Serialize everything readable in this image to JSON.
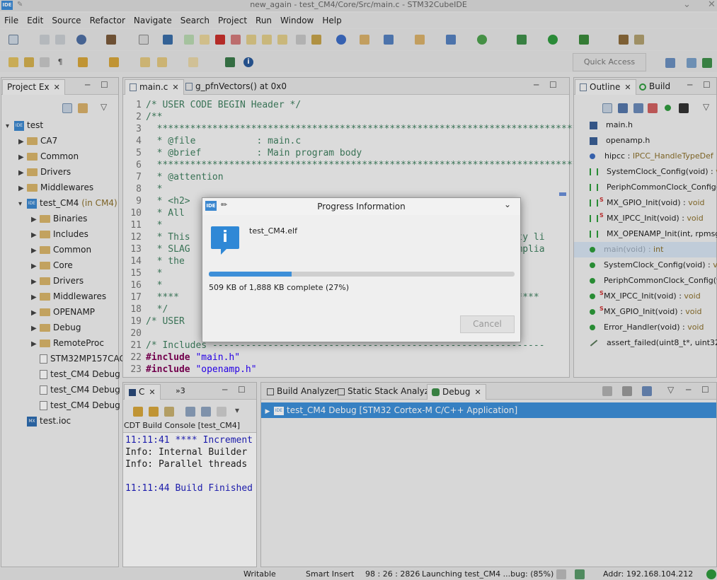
{
  "window": {
    "title": "new_again - test_CM4/Core/Src/main.c - STM32CubeIDE",
    "logo": "IDE"
  },
  "menu": [
    "File",
    "Edit",
    "Source",
    "Refactor",
    "Navigate",
    "Search",
    "Project",
    "Run",
    "Window",
    "Help"
  ],
  "toolbar": {
    "quick_access": "Quick Access"
  },
  "project_explorer": {
    "tab": "Project Ex",
    "root": "test",
    "items": [
      {
        "label": "CA7",
        "kind": "folder",
        "level": 1
      },
      {
        "label": "Common",
        "kind": "folder",
        "level": 1
      },
      {
        "label": "Drivers",
        "kind": "folder",
        "level": 1
      },
      {
        "label": "Middlewares",
        "kind": "folder",
        "level": 1
      },
      {
        "label": "test_CM4",
        "suffix": "(in CM4)",
        "kind": "project",
        "level": 1
      },
      {
        "label": "Binaries",
        "kind": "folder",
        "level": 2
      },
      {
        "label": "Includes",
        "kind": "folder",
        "level": 2
      },
      {
        "label": "Common",
        "kind": "folder",
        "level": 2
      },
      {
        "label": "Core",
        "kind": "folder",
        "level": 2
      },
      {
        "label": "Drivers",
        "kind": "folder",
        "level": 2
      },
      {
        "label": "Middlewares",
        "kind": "folder",
        "level": 2
      },
      {
        "label": "OPENAMP",
        "kind": "folder",
        "level": 2
      },
      {
        "label": "Debug",
        "kind": "folder",
        "level": 2
      },
      {
        "label": "RemoteProc",
        "kind": "folder",
        "level": 2
      },
      {
        "label": "STM32MP157CAC",
        "kind": "file",
        "level": 2
      },
      {
        "label": "test_CM4 Debug",
        "kind": "file",
        "level": 2
      },
      {
        "label": "test_CM4 Debug",
        "kind": "file",
        "level": 2
      },
      {
        "label": "test_CM4 Debug",
        "kind": "file",
        "level": 2
      },
      {
        "label": "test.ioc",
        "kind": "ioc",
        "level": 1
      }
    ]
  },
  "editor": {
    "tabs": [
      "main.c",
      "g_pfnVectors() at 0x0"
    ],
    "lines": [
      {
        "n": "1",
        "text": "/* USER CODE BEGIN Header */",
        "cls": "cm"
      },
      {
        "n": "2",
        "text": "/**",
        "cls": "cm"
      },
      {
        "n": "3",
        "text": "  ******************************************************************************",
        "cls": "cm"
      },
      {
        "n": "4",
        "text": "  * @file           : main.c",
        "cls": "cm"
      },
      {
        "n": "5",
        "text": "  * @brief          : Main program body",
        "cls": "cm"
      },
      {
        "n": "6",
        "text": "  ******************************************************************************",
        "cls": "cm"
      },
      {
        "n": "7",
        "text": "  * @attention",
        "cls": "cm"
      },
      {
        "n": "8",
        "text": "  *",
        "cls": "cm"
      },
      {
        "n": "9",
        "text": "  * <h2>",
        "cls": "cm"
      },
      {
        "n": "10",
        "text": "  * All",
        "cls": "cm"
      },
      {
        "n": "11",
        "text": "  *",
        "cls": "cm"
      },
      {
        "n": "12",
        "text": "  * This                                                         erty li",
        "cls": "cm"
      },
      {
        "n": "13",
        "text": "  * SLAG                                                         complia",
        "cls": "cm"
      },
      {
        "n": "14",
        "text": "  * the",
        "cls": "cm"
      },
      {
        "n": "15",
        "text": "  *",
        "cls": "cm"
      },
      {
        "n": "16",
        "text": "  *",
        "cls": "cm"
      },
      {
        "n": "17",
        "text": "  ****                                                         ********",
        "cls": "cm"
      },
      {
        "n": "18",
        "text": "  */",
        "cls": "cm"
      },
      {
        "n": "19",
        "text": "/* USER",
        "cls": "cm"
      },
      {
        "n": "20",
        "text": "",
        "cls": "cm"
      },
      {
        "n": "21",
        "text": "/* Includes ------------------------------------------------------------",
        "cls": "cm"
      },
      {
        "n": "22",
        "text": "#include \"main.h\"",
        "cls": "inc"
      },
      {
        "n": "23",
        "text": "#include \"openamp.h\"",
        "cls": "inc"
      }
    ]
  },
  "outline": {
    "tabs": [
      "Outline",
      "Build"
    ],
    "items": [
      {
        "name": "main.h",
        "type": "",
        "icon": "include"
      },
      {
        "name": "openamp.h",
        "type": "",
        "icon": "include"
      },
      {
        "name": "hipcc : ",
        "type": "IPCC_HandleTypeDef",
        "icon": "var"
      },
      {
        "name": "SystemClock_Config(void) : ",
        "type": "void",
        "icon": "decl"
      },
      {
        "name": "PeriphCommonClock_Config(vo",
        "type": "",
        "icon": "decl"
      },
      {
        "name": "MX_GPIO_Init(void) : ",
        "type": "void",
        "icon": "static-decl"
      },
      {
        "name": "MX_IPCC_Init(void) : ",
        "type": "void",
        "icon": "static-decl"
      },
      {
        "name": "MX_OPENAMP_Init(int, rpmsg_",
        "type": "",
        "icon": "decl"
      },
      {
        "name": "main(void) : ",
        "type": "int",
        "icon": "func",
        "selected": true
      },
      {
        "name": "SystemClock_Config(void) : ",
        "type": "void",
        "icon": "func"
      },
      {
        "name": "PeriphCommonClock_Config(vo",
        "type": "",
        "icon": "func"
      },
      {
        "name": "MX_IPCC_Init(void) : ",
        "type": "void",
        "icon": "static-func"
      },
      {
        "name": "MX_GPIO_Init(void) : ",
        "type": "void",
        "icon": "static-func"
      },
      {
        "name": "Error_Handler(void) : ",
        "type": "void",
        "icon": "func"
      },
      {
        "name": "assert_failed(uint8_t*, uint32_",
        "type": "",
        "icon": "disabled"
      }
    ]
  },
  "console": {
    "tabs": [
      "C",
      "»3"
    ],
    "title": "CDT Build Console [test_CM4]",
    "lines": [
      {
        "text": "11:11:41 **** Increment",
        "color": "#1f1fbf"
      },
      {
        "text": "Info: Internal Builder",
        "color": "#222222"
      },
      {
        "text": "Info: Parallel threads",
        "color": "#222222"
      },
      {
        "text": "",
        "color": "#222222"
      },
      {
        "text": "11:11:44 Build Finished",
        "color": "#1f1fbf"
      }
    ]
  },
  "debug": {
    "tabs": [
      "Build Analyzer",
      "Static Stack Analyzer",
      "Debug"
    ],
    "item": "test_CM4 Debug [STM32 Cortex-M C/C++ Application]"
  },
  "status": {
    "writable": "Writable",
    "insert": "Smart Insert",
    "position": "98 : 26 : 2826",
    "launching": "Launching test_CM4 ...bug: (85%)",
    "addr": "Addr: 192.168.104.212"
  },
  "dialog": {
    "title": "Progress Information",
    "file": "test_CM4.elf",
    "progress_text": "509 KB of 1,888 KB complete (27%)",
    "progress": 0.27,
    "cancel": "Cancel"
  },
  "colors": {
    "accent": "#3d8fd8",
    "selection": "#9fc4e8"
  }
}
